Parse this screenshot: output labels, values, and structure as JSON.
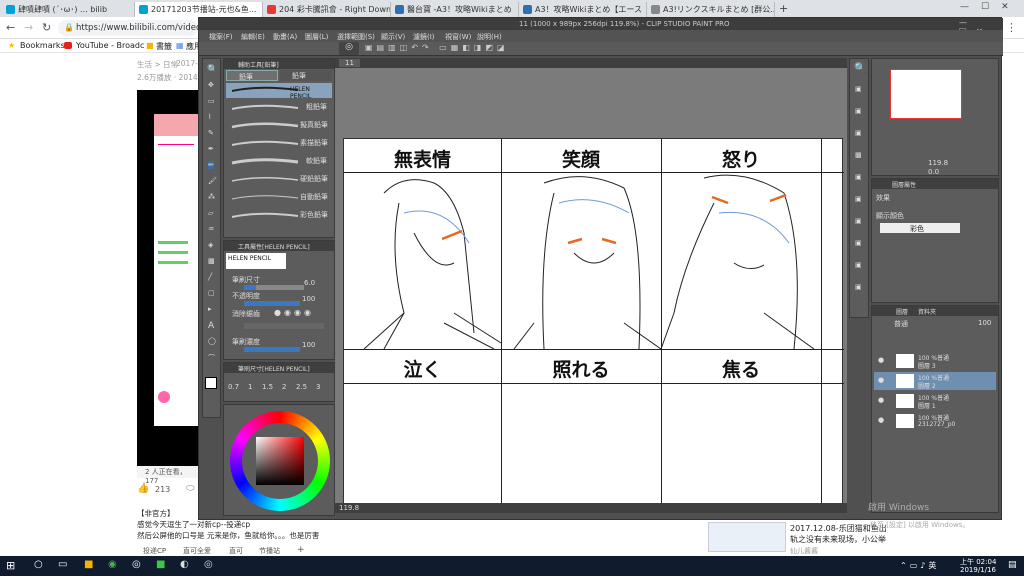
{
  "browser": {
    "tabs": [
      {
        "label": "肆嘖肆嘖 (´･ω･) ... bilib",
        "color": "#00a1d6",
        "active": false
      },
      {
        "label": "20171203节播站-元也&鱼...",
        "color": "#00a1d6",
        "active": true
      },
      {
        "label": "204 彩卡騰訊會 - Right Down",
        "color": "#e53935",
        "active": false
      },
      {
        "label": "醫台寶 -A3！攻略Wikiまとめ",
        "color": "#2d6fb5",
        "active": false
      },
      {
        "label": "A3！攻略Wikiまとめ【エース",
        "color": "#2d6fb5",
        "active": false
      },
      {
        "label": "A3!リンクスキルまとめ [群公...",
        "color": "#888888",
        "active": false
      }
    ],
    "url": "https://www.bilibili.com/video/av1",
    "bookmarks": [
      {
        "label": "Bookmarks"
      },
      {
        "label": "YouTube - Broadc"
      },
      {
        "label": "書籤"
      },
      {
        "label": "應用"
      }
    ]
  },
  "bilibili": {
    "category": "生活 > 日常",
    "date": "2017-1",
    "views": "2.6万播放 · 2014弹幕",
    "online": "2 人正在看，177",
    "likes": "213",
    "uploader_header": "【非官方】",
    "desc_line1": "感觉今天逗生了一对新cp--投递cp",
    "desc_line2": "然后公屏他的口号是 元来是你，鱼就给你。。。也是厉害",
    "tags": [
      "投递CP",
      "直可全爱",
      "直可",
      "节播站"
    ],
    "related_title": "2017.12.08-乐团猫和鱼出",
    "related_sub": "轨之没有未来现场，小公举",
    "related_author": "仙儿酱酱"
  },
  "csp": {
    "title": "11 (1000 x 989px 256dpi 119.8%) - CLIP STUDIO PAINT PRO",
    "menu": [
      "檔案(F)",
      "編輯(E)",
      "動畫(A)",
      "圖層(L)",
      "選擇範圍(S)",
      "顯示(V)",
      "濾鏡(I)",
      "視窗(W)",
      "說明(H)"
    ],
    "canvas_tab": "11",
    "brush_tabs": [
      "鉛筆",
      "鉛筆"
    ],
    "subtool_header": "輔助工具[鉛筆]",
    "brushes": [
      "HELEN PENCIL",
      "粗鉛筆",
      "擬真鉛筆",
      "素描鉛筆",
      "軟鉛筆",
      "硬鉛鉛筆",
      "自動鉛筆",
      "彩色鉛筆"
    ],
    "prop_header": "工具屬性[HELEN PENCIL]",
    "prop_brush": "HELEN PENCIL",
    "brush_size_label": "筆刷尺寸",
    "brush_size": "6.0",
    "opacity_label": "不透明度",
    "opacity": "100",
    "aa_label": "消除鋸齒",
    "density_label": "筆刷濃度",
    "density": "100",
    "size_header": "筆刷尺寸[HELEN PENCIL]",
    "size_presets": [
      "0.7",
      "1",
      "1.5",
      "2",
      "2.5",
      "3"
    ],
    "zoom": "119.8",
    "nav_zoom": "119.8",
    "nav_angle": "0.0",
    "prop_panel_title": "圖層屬性",
    "effect_label": "效果",
    "color_label": "顯示顏色",
    "color_value": "彩色",
    "layer_tab1": "圖層",
    "layer_tab2": "資料夾",
    "blend_mode": "普通",
    "layer_opacity": "100",
    "layers": [
      {
        "pct": "100 %普通",
        "name": "圖層 3",
        "selected": false
      },
      {
        "pct": "100 %普通",
        "name": "圖層 2",
        "selected": true
      },
      {
        "pct": "100 %普通",
        "name": "圖層 1",
        "selected": false
      },
      {
        "pct": "100 %普通",
        "name": "2312727_p0",
        "selected": false
      }
    ],
    "cells_top": [
      "無表情",
      "笑顔",
      "怒り"
    ],
    "cells_bottom": [
      "泣く",
      "照れる",
      "焦る"
    ],
    "activate_windows": "啟用 Windows",
    "activate_sub": "移至 [設定] 以啟用 Windows。"
  },
  "taskbar": {
    "time": "上午 02:04",
    "date": "2019/1/16"
  },
  "colors": {
    "accent_orange": "#e8691e",
    "sketch_blue": "#6f9bd8",
    "taskbar": "#101b2d"
  }
}
